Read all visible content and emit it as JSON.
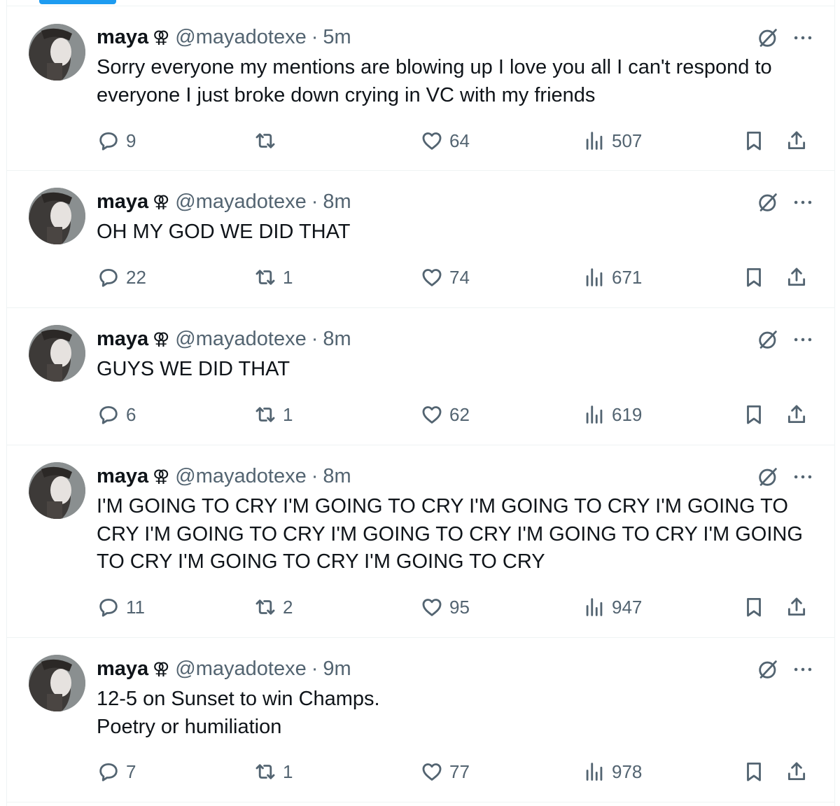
{
  "tweets": [
    {
      "name": "maya",
      "name_symbol": "⚢",
      "handle": "@mayadotexe",
      "separator": "·",
      "time": "5m",
      "text": "Sorry everyone my mentions are blowing up I love you all I can't respond to everyone I just broke down crying in VC with my friends",
      "replies": "9",
      "retweets": "",
      "likes": "64",
      "views": "507"
    },
    {
      "name": "maya",
      "name_symbol": "⚢",
      "handle": "@mayadotexe",
      "separator": "·",
      "time": "8m",
      "text": "OH MY GOD WE DID THAT",
      "replies": "22",
      "retweets": "1",
      "likes": "74",
      "views": "671"
    },
    {
      "name": "maya",
      "name_symbol": "⚢",
      "handle": "@mayadotexe",
      "separator": "·",
      "time": "8m",
      "text": "GUYS WE DID THAT",
      "replies": "6",
      "retweets": "1",
      "likes": "62",
      "views": "619"
    },
    {
      "name": "maya",
      "name_symbol": "⚢",
      "handle": "@mayadotexe",
      "separator": "·",
      "time": "8m",
      "text": "I'M GOING TO CRY I'M GOING TO CRY I'M GOING TO CRY I'M GOING TO CRY I'M GOING TO CRY I'M GOING TO CRY I'M GOING TO CRY I'M GOING TO CRY I'M GOING TO CRY I'M GOING TO CRY",
      "replies": "11",
      "retweets": "2",
      "likes": "95",
      "views": "947"
    },
    {
      "name": "maya",
      "name_symbol": "⚢",
      "handle": "@mayadotexe",
      "separator": "·",
      "time": "9m",
      "text": "12-5 on Sunset to win Champs.\nPoetry or humiliation",
      "replies": "7",
      "retweets": "1",
      "likes": "77",
      "views": "978"
    }
  ],
  "icons": {
    "reply": "reply-icon",
    "retweet": "retweet-icon",
    "like": "heart-icon",
    "views": "views-icon",
    "bookmark": "bookmark-icon",
    "share": "share-icon",
    "grok": "grok-icon",
    "more": "more-icon"
  },
  "colors": {
    "text": "#0f1419",
    "secondary": "#536471",
    "divider": "#eff3f4",
    "accent": "#1d9bf0"
  }
}
